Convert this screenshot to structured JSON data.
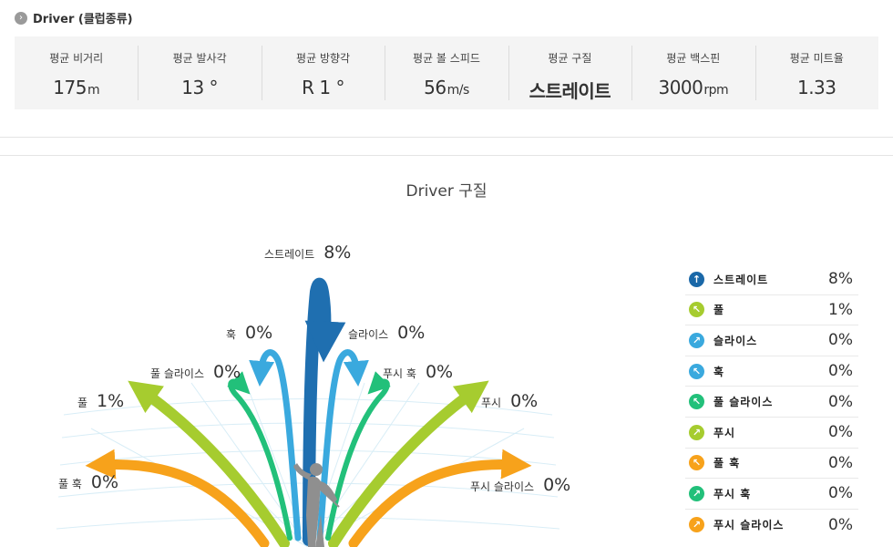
{
  "header": {
    "title": "Driver (클럽종류)"
  },
  "stats": [
    {
      "label": "평균 비거리",
      "value": "175",
      "unit": "m"
    },
    {
      "label": "평균 발사각",
      "value": "13 °",
      "unit": ""
    },
    {
      "label": "평균 방향각",
      "value": "R 1 °",
      "unit": ""
    },
    {
      "label": "평균 볼 스피드",
      "value": "56",
      "unit": "m/s"
    },
    {
      "label": "평균 구질",
      "value": "스트레이트",
      "unit": ""
    },
    {
      "label": "평균 백스핀",
      "value": "3000",
      "unit": "rpm"
    },
    {
      "label": "평균 미트율",
      "value": "1.33",
      "unit": ""
    }
  ],
  "chart": {
    "title": "Driver 구질",
    "labels": {
      "straight": {
        "name": "스트레이트",
        "pct": "8%"
      },
      "hook": {
        "name": "훅",
        "pct": "0%"
      },
      "slice": {
        "name": "슬라이스",
        "pct": "0%"
      },
      "pull_slice": {
        "name": "풀 슬라이스",
        "pct": "0%"
      },
      "push_hook": {
        "name": "푸시 훅",
        "pct": "0%"
      },
      "pull": {
        "name": "풀",
        "pct": "1%"
      },
      "push": {
        "name": "푸시",
        "pct": "0%"
      },
      "pull_hook": {
        "name": "풀 훅",
        "pct": "0%"
      },
      "push_slice": {
        "name": "푸시 슬라이스",
        "pct": "0%"
      }
    },
    "colors": {
      "straight": "#1f6fb0",
      "hook_slice": "#3aa9de",
      "pull_slice_push_hook": "#22c07a",
      "pull_push": "#a6cc2f",
      "pull_hook_push_slice": "#f7a21b"
    }
  },
  "legend": [
    {
      "name": "스트레이트",
      "pct": "8%",
      "color": "#1a68a8",
      "icon": "↑"
    },
    {
      "name": "풀",
      "pct": "1%",
      "color": "#a6cc2f",
      "icon": "↖"
    },
    {
      "name": "슬라이스",
      "pct": "0%",
      "color": "#3aa9de",
      "icon": "↗"
    },
    {
      "name": "훅",
      "pct": "0%",
      "color": "#3aa9de",
      "icon": "↖"
    },
    {
      "name": "풀 슬라이스",
      "pct": "0%",
      "color": "#22c07a",
      "icon": "↖"
    },
    {
      "name": "푸시",
      "pct": "0%",
      "color": "#a6cc2f",
      "icon": "↗"
    },
    {
      "name": "풀 훅",
      "pct": "0%",
      "color": "#f7a21b",
      "icon": "↖"
    },
    {
      "name": "푸시 훅",
      "pct": "0%",
      "color": "#22c07a",
      "icon": "↗"
    },
    {
      "name": "푸시 슬라이스",
      "pct": "0%",
      "color": "#f7a21b",
      "icon": "↗"
    }
  ]
}
